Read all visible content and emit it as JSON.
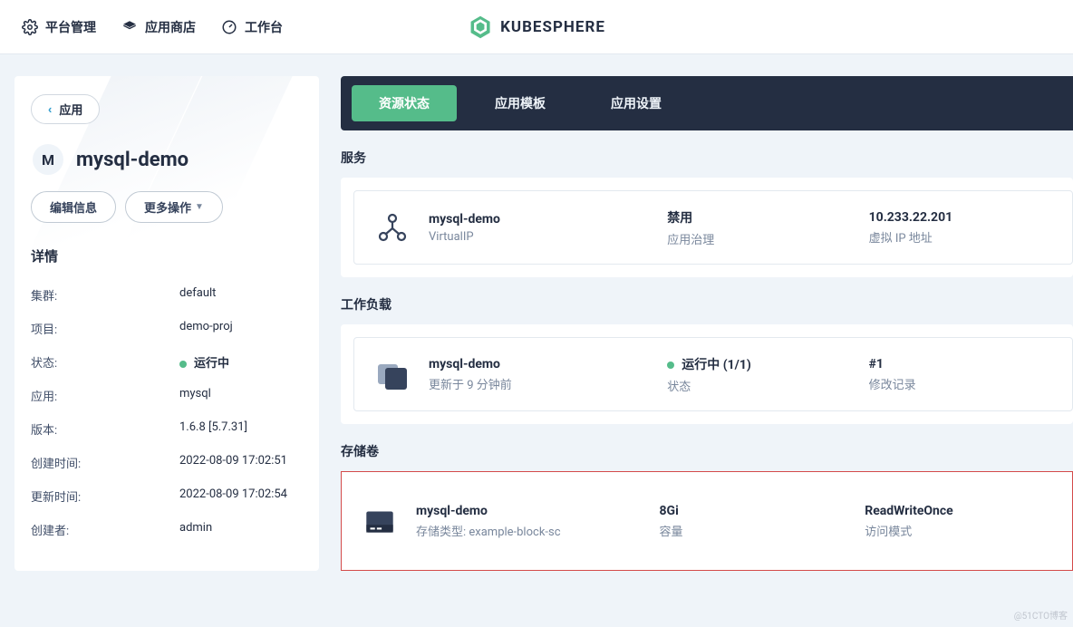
{
  "nav": {
    "platform": "平台管理",
    "appstore": "应用商店",
    "workbench": "工作台",
    "brand": "KUBESPHERE"
  },
  "sidebar": {
    "back": "应用",
    "titleBadge": "M",
    "title": "mysql-demo",
    "editBtn": "编辑信息",
    "moreBtn": "更多操作",
    "detailsHeader": "详情",
    "rows": [
      {
        "label": "集群:",
        "value": "default"
      },
      {
        "label": "项目:",
        "value": "demo-proj"
      },
      {
        "label": "状态:",
        "value": "运行中",
        "status": true
      },
      {
        "label": "应用:",
        "value": "mysql"
      },
      {
        "label": "版本:",
        "value": "1.6.8 [5.7.31]"
      },
      {
        "label": "创建时间:",
        "value": "2022-08-09 17:02:51"
      },
      {
        "label": "更新时间:",
        "value": "2022-08-09 17:02:54"
      },
      {
        "label": "创建者:",
        "value": "admin"
      }
    ]
  },
  "tabs": [
    "资源状态",
    "应用模板",
    "应用设置"
  ],
  "service": {
    "header": "服务",
    "name": "mysql-demo",
    "sub": "VirtualIP",
    "c2t": "禁用",
    "c2s": "应用治理",
    "c3t": "10.233.22.201",
    "c3s": "虚拟 IP 地址"
  },
  "workload": {
    "header": "工作负载",
    "name": "mysql-demo",
    "sub": "更新于 9 分钟前",
    "c2t": "运行中 (1/1)",
    "c2s": "状态",
    "c3t": "#1",
    "c3s": "修改记录"
  },
  "volume": {
    "header": "存储卷",
    "name": "mysql-demo",
    "sub": "存储类型: example-block-sc",
    "c2t": "8Gi",
    "c2s": "容量",
    "c3t": "ReadWriteOnce",
    "c3s": "访问模式"
  },
  "watermark": "@51CTO博客"
}
